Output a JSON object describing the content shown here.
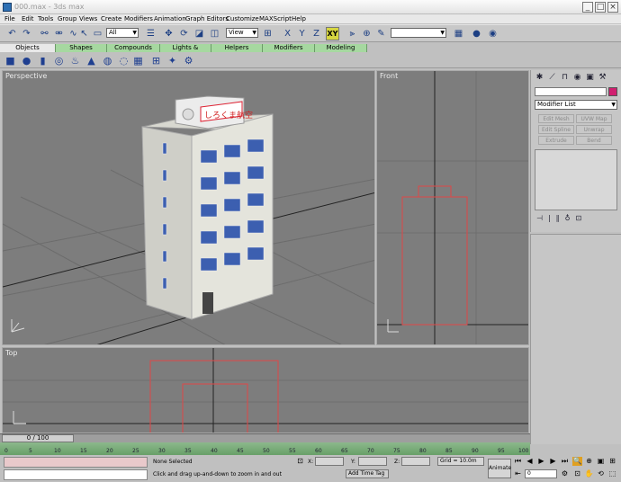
{
  "window": {
    "title": "000.max - 3ds max",
    "min_label": "_",
    "max_label": "□",
    "close_label": "×"
  },
  "menu": [
    "File",
    "Edit",
    "Tools",
    "Group",
    "Views",
    "Create",
    "Modifiers",
    "Animation",
    "Graph Editors",
    "Customize",
    "MAXScript",
    "Help"
  ],
  "toolbar": {
    "selection_filter": "All",
    "reference_coord": "View",
    "active_axis_label": "XY",
    "axis_labels": [
      "X",
      "Y",
      "Z"
    ]
  },
  "tabs": [
    "Objects",
    "Shapes",
    "Compounds",
    "Lights & Cameras",
    "Helpers",
    "Modifiers",
    "Modeling"
  ],
  "viewports": {
    "perspective": "Perspective",
    "front": "Front",
    "top": "Top"
  },
  "building_sign": "しろくま航空",
  "command_panel": {
    "modifier_list": "Modifier List",
    "buttons": [
      "Edit Mesh",
      "UVW Map",
      "Edit Spline",
      "Unwrap UVW",
      "Extrude",
      "Bend"
    ]
  },
  "timeline": {
    "frame_label": "0 / 100",
    "ticks": [
      "0",
      "5",
      "10",
      "15",
      "20",
      "25",
      "30",
      "35",
      "40",
      "45",
      "50",
      "55",
      "60",
      "65",
      "70",
      "75",
      "80",
      "85",
      "90",
      "95",
      "100"
    ]
  },
  "status": {
    "selection": "None Selected",
    "prompt": "Click and drag up-and-down to zoom in and out",
    "x_label": "X:",
    "y_label": "Y:",
    "z_label": "Z:",
    "grid": "Grid = 10.0m",
    "add_time_tag": "Add Time Tag",
    "animate": "Animate",
    "frame_value": "0"
  },
  "colors": {
    "viewport_bg": "#7d7d7d",
    "tab_green": "#a6d8a0",
    "timeline_green": "#68a068",
    "status_pink": "#e9c9cb",
    "object_color": "#e04848"
  }
}
